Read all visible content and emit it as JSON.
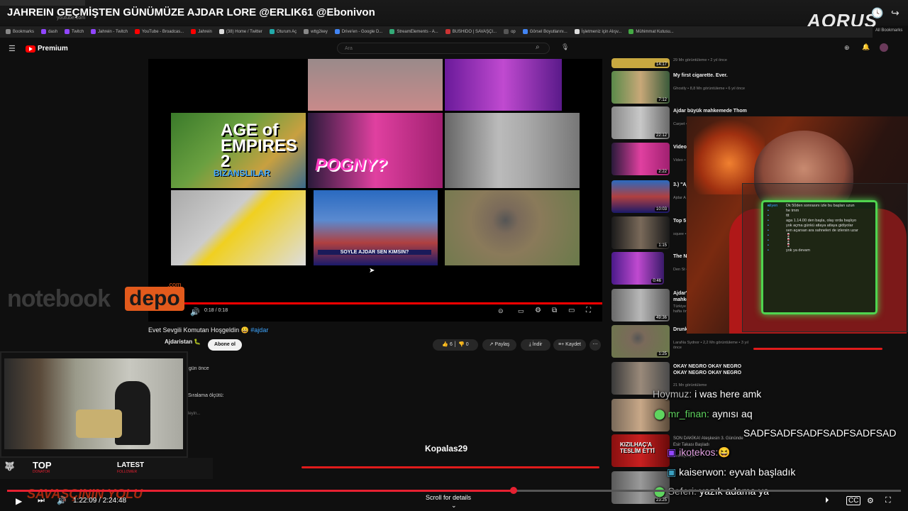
{
  "stream": {
    "title": "JAHREIN GEÇMİŞTEN GÜNÜMÜZE AJDAR LORE @ERLIK61 @Ebonivon",
    "elapsed": "1:22:09",
    "duration": "2:24:48",
    "progress_fraction": 0.567,
    "scroll_hint": "Scroll for details",
    "brand": "AORUS"
  },
  "browser": {
    "address": "youtube.com",
    "bookmarks": [
      "Bookmarks",
      "dash",
      "Twitch",
      "Jahrein - Twitch",
      "YouTube - Broadcas...",
      "Jahrein",
      "(38) Home / Twitter",
      "Oturum Aç",
      "wttg2key",
      "Drive'en - Google D...",
      "StreamElements - A...",
      "BUSHIDO | SAVAŞÇI...",
      "op",
      "Görsel Boyutlarını...",
      "İşletmeniz için Alışv...",
      "Mühimmat Kutusu..."
    ],
    "all_bookmarks": "All Bookmarks"
  },
  "youtube": {
    "logo": "Premium",
    "search_placeholder": "Ara",
    "video": {
      "time": "0:18 / 0:18",
      "thumb_text_1": "AGE of EMPIRES 2",
      "thumb_text_2": "BIZANSLILAR",
      "thumb_text_3": "POGNY?",
      "thumb_text_4": "SOYLE AJDAR SEN KIMSIN?"
    },
    "title": "Evet Sevgili Komutan Hoşgeldin 😀",
    "hashtag": "#ajdar",
    "channel": "Ajdaristan 🐛",
    "subscribe": "Abone ol",
    "likes": "6",
    "dislikes": "0",
    "share": "Paylaş",
    "download": "İndir",
    "save": "Kaydet",
    "posted": "7 gün önce",
    "sort": "Sıralama ölçütü:",
    "comment_placeholder": "kleyin..."
  },
  "sidebar": [
    {
      "title": "",
      "meta": "29 Mn görüntüleme • 2 yıl önce",
      "duration": "14:17"
    },
    {
      "title": "My first cigarette. Ever.",
      "meta": "Ghostly • 8,8 Mn görüntüleme • 6 yıl önce",
      "duration": "7:12"
    },
    {
      "title": "Ajdar büyük mahkemede Thom",
      "meta": "Carpet • 40 B g",
      "duration": "22:12"
    },
    {
      "title": "Video Oyunl",
      "meta": "Video • 6,4 B g",
      "duration": "2:22"
    },
    {
      "title": "3.) \"Aj star \"",
      "meta": "Ajdar A • 4 B g",
      "duration": "10:03"
    },
    {
      "title": "Top 5",
      "meta": "squee • 55 Mn",
      "duration": "1:15"
    },
    {
      "title": "The N",
      "meta": "Den St • 28 Mn",
      "duration": "0:46"
    },
    {
      "title": "Ajdar'ın unutulmayan mahkemesi Part/1",
      "meta": "Türkiye Kanalı Kuşlar • 15 B görüntüleme • 4 hafta önce",
      "duration": "49:36"
    },
    {
      "title": "Drunk Pig",
      "meta": "LaraNa Sydnor • 2,2 Mn görüntüleme • 3 yıl önce",
      "duration": "1:25"
    },
    {
      "title": "OKAY NEGRO OKAY NEGRO OKAY NEGRO OKAY NEGRO",
      "meta": "21 Mn görüntüleme",
      "duration": ""
    },
    {
      "title": "",
      "meta": "",
      "duration": ""
    },
    {
      "title": "SON DAKİKA! Ateşkesin 3. Gününde Esir Takası Başladı",
      "meta": "Belediyespor",
      "duration": ""
    },
    {
      "title": "",
      "meta": "",
      "duration": "23:25"
    }
  ],
  "webcam_chat": [
    {
      "user": "aliyen",
      "msg": ""
    },
    {
      "user": "user",
      "msg": "Dk 50den sonrasını izle bu başları uzun"
    },
    {
      "user": "user",
      "msg": "he tmm"
    },
    {
      "user": "user",
      "msg": "ttt"
    },
    {
      "user": "user",
      "msg": "aga 1.14.00 den başla, olay orda başlıyo"
    },
    {
      "user": "user",
      "msg": "yok açma günkü atlaya atlaya gidiyolar"
    },
    {
      "user": "user",
      "msg": "sen açarsan ara sahneleri de izlersin uzar"
    },
    {
      "user": "user",
      "msg": "🍷"
    },
    {
      "user": "user",
      "msg": "🍷"
    },
    {
      "user": "user",
      "msg": "🍷"
    },
    {
      "user": "user",
      "msg": "yok ya devam"
    }
  ],
  "overlay_chat": [
    {
      "name": "Hoymuz:",
      "msg": "i was here amk"
    },
    {
      "name": "mr_finan:",
      "msg": "aynısı aq"
    },
    {
      "name": "",
      "msg": "SADFSADFSADFSADFSADFSAD"
    },
    {
      "name": "ikotekos:",
      "msg": "😆"
    },
    {
      "name": "kaiserwon:",
      "msg": "eyvah başladık"
    },
    {
      "name": "Seferi:",
      "msg": "yazık adama ya"
    }
  ],
  "overlays": {
    "sponsor_1": "notebook",
    "sponsor_2": "depo",
    "sponsor_com": ".com",
    "top_label": "TOP",
    "top_sub": "DONATOR",
    "latest_label": "LATEST",
    "latest_sub": "FOLLOWER",
    "ticker": "SAVAŞÇININ YOLU",
    "alert_name": "Kopalas29"
  },
  "colors": {
    "accent_red": "#e62131",
    "chat_green": "#4fd44f"
  }
}
